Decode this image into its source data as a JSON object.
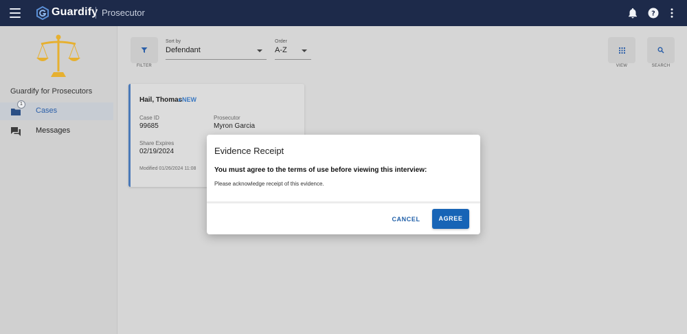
{
  "header": {
    "brand": "Guardify",
    "subtitle": "Prosecutor",
    "icons": [
      "menu-icon",
      "guardify-logo-icon",
      "bell-icon",
      "help-icon",
      "more-vert-icon"
    ]
  },
  "sidebar": {
    "title": "Guardify for Prosecutors",
    "items": [
      {
        "label": "Cases",
        "icon": "folder-icon",
        "badge": "1",
        "active": true
      },
      {
        "label": "Messages",
        "icon": "chat-icon",
        "active": false
      }
    ]
  },
  "toolbar": {
    "filter_label": "FILTER",
    "sort": {
      "label": "Sort by",
      "value": "Defendant"
    },
    "order": {
      "label": "Order",
      "value": "A-Z"
    },
    "view_label": "VIEW",
    "search_label": "SEARCH"
  },
  "case_card": {
    "name": "Hail, Thomas",
    "status": "NEW",
    "case_id_label": "Case ID",
    "case_id": "99685",
    "prosecutor_label": "Prosecutor",
    "prosecutor": "Myron Garcia",
    "share_expires_label": "Share Expires",
    "share_expires": "02/19/2024",
    "modified": "Modified 01/26/2024 11:08"
  },
  "modal": {
    "title": "Evidence Receipt",
    "heading": "You must agree to the terms of use before viewing this interview:",
    "text": "Please acknowledge receipt of this evidence.",
    "cancel_label": "CANCEL",
    "agree_label": "AGREE"
  },
  "colors": {
    "header_bg": "#1d2a4a",
    "accent": "#1764b6",
    "overlay_bg": "#d6d6d6",
    "gold": "#e6b030"
  }
}
